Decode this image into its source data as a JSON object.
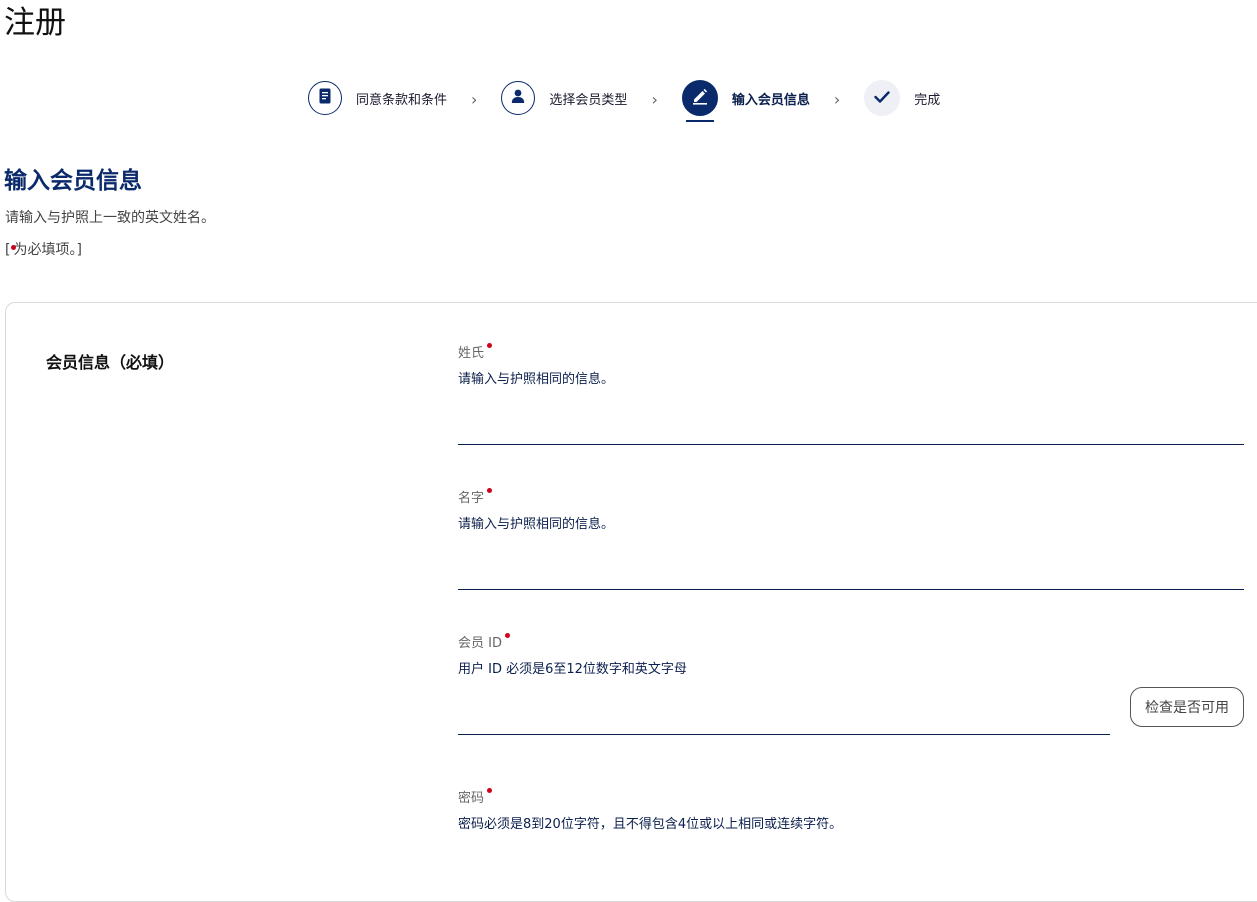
{
  "page": {
    "title": "注册"
  },
  "stepper": {
    "steps": [
      {
        "label": "同意条款和条件",
        "icon": "document-icon",
        "state": "completed"
      },
      {
        "label": "选择会员类型",
        "icon": "user-icon",
        "state": "completed"
      },
      {
        "label": "输入会员信息",
        "icon": "pencil-icon",
        "state": "active"
      },
      {
        "label": "完成",
        "icon": "check-icon",
        "state": "pending"
      }
    ],
    "separator": "›"
  },
  "section": {
    "title": "输入会员信息",
    "description": "请输入与护照上一致的英文姓名。",
    "required_note_prefix": "[",
    "required_note_text": "为必填项。]"
  },
  "form": {
    "heading": "会员信息（必填）",
    "fields": {
      "last_name": {
        "label": "姓氏",
        "hint": "请输入与护照相同的信息。",
        "value": ""
      },
      "first_name": {
        "label": "名字",
        "hint": "请输入与护照相同的信息。",
        "value": ""
      },
      "member_id": {
        "label": "会员 ID",
        "hint": "用户 ID 必须是6至12位数字和英文字母",
        "value": "",
        "check_button_label": "检查是否可用"
      },
      "password": {
        "label": "密码",
        "hint": "密码必须是8到20位字符，且不得包含4位或以上相同或连续字符。"
      }
    }
  },
  "colors": {
    "brand_navy": "#0b2a6b",
    "required_red": "#d0021b",
    "border_gray": "#d9d9d9"
  }
}
